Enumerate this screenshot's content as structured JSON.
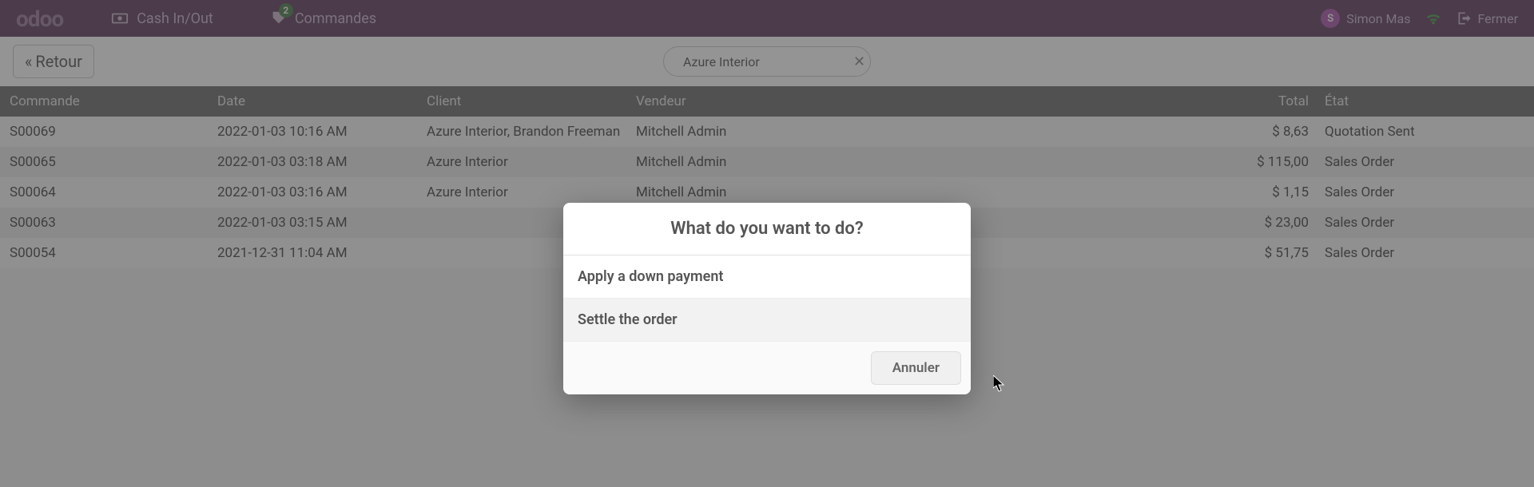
{
  "header": {
    "logo": "odoo",
    "cash_label": "Cash In/Out",
    "orders_label": "Commandes",
    "orders_badge": "2",
    "user_initial": "S",
    "user_name": "Simon Mas",
    "close_label": "Fermer"
  },
  "toolbar": {
    "back_label": "Retour",
    "search_value": "Azure Interior"
  },
  "columns": {
    "order": "Commande",
    "date": "Date",
    "client": "Client",
    "seller": "Vendeur",
    "total": "Total",
    "state": "État"
  },
  "rows": [
    {
      "order": "S00069",
      "date": "2022-01-03 10:16 AM",
      "client": "Azure Interior, Brandon Freeman",
      "seller": "Mitchell Admin",
      "total": "$ 8,63",
      "state": "Quotation Sent"
    },
    {
      "order": "S00065",
      "date": "2022-01-03 03:18 AM",
      "client": "Azure Interior",
      "seller": "Mitchell Admin",
      "total": "$ 115,00",
      "state": "Sales Order"
    },
    {
      "order": "S00064",
      "date": "2022-01-03 03:16 AM",
      "client": "Azure Interior",
      "seller": "Mitchell Admin",
      "total": "$ 1,15",
      "state": "Sales Order"
    },
    {
      "order": "S00063",
      "date": "2022-01-03 03:15 AM",
      "client": "",
      "seller": "",
      "total": "$ 23,00",
      "state": "Sales Order"
    },
    {
      "order": "S00054",
      "date": "2021-12-31 11:04 AM",
      "client": "",
      "seller": "",
      "total": "$ 51,75",
      "state": "Sales Order"
    }
  ],
  "modal": {
    "title": "What do you want to do?",
    "opt1": "Apply a down payment",
    "opt2": "Settle the order",
    "cancel": "Annuler"
  }
}
